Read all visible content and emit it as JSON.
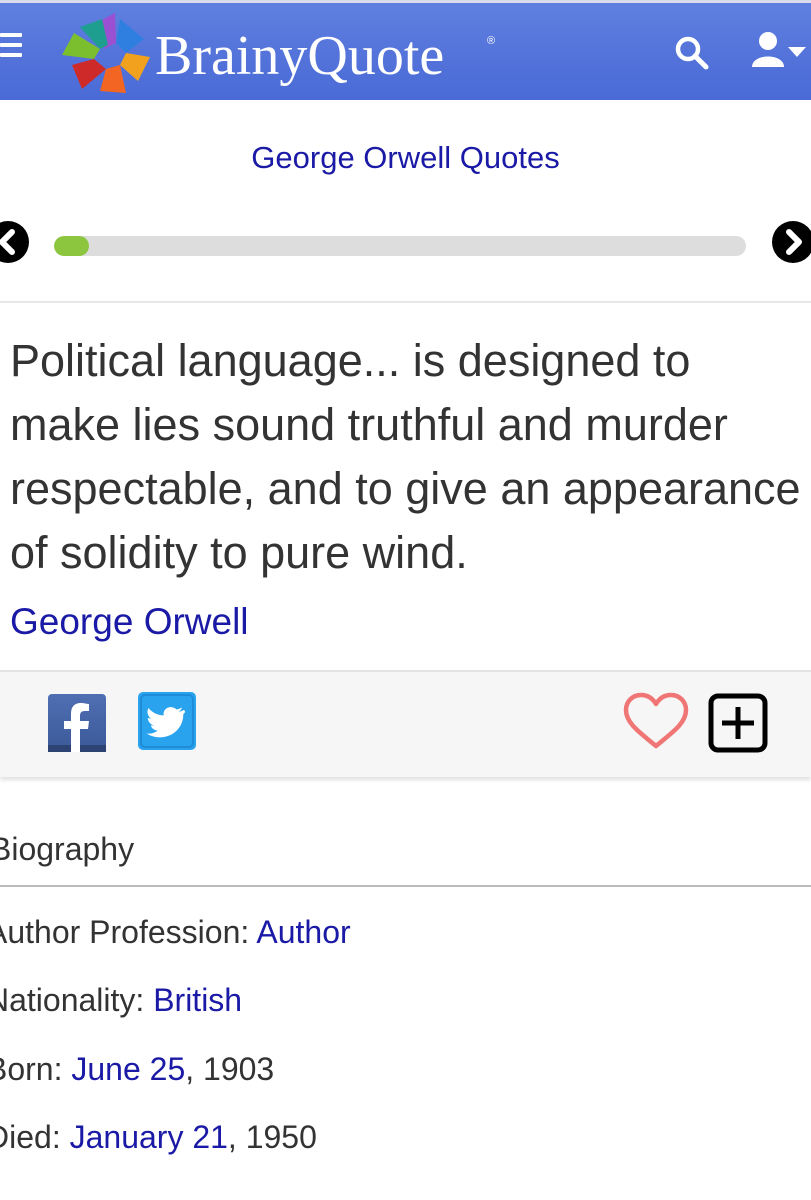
{
  "header": {
    "logo_text": "BrainyQuote",
    "logo_reg": "®",
    "icons": {
      "menu": "hamburger-icon",
      "search": "search-icon",
      "user": "user-icon"
    },
    "colors": {
      "bar": "#5272dc",
      "link": "#1a1aa6",
      "progress": "#8cc63f"
    }
  },
  "page": {
    "title": "George Orwell Quotes",
    "progress_fraction": 0.05
  },
  "quote": {
    "text": "Political language... is designed to make lies sound truthful and murder respectable, and to give an appearance of solidity to pure wind.",
    "author": "George Orwell"
  },
  "share": {
    "icons": [
      "facebook-icon",
      "twitter-icon",
      "heart-icon",
      "plus-box-icon"
    ]
  },
  "bio": {
    "heading": "Biography",
    "profession_label": "Author Profession: ",
    "profession_value": "Author",
    "nationality_label": "Nationality: ",
    "nationality_value": "British",
    "born_label": "Born: ",
    "born_date": "June 25",
    "born_year": ", 1903",
    "died_label": "Died: ",
    "died_date": "January 21",
    "died_year": ", 1950"
  }
}
